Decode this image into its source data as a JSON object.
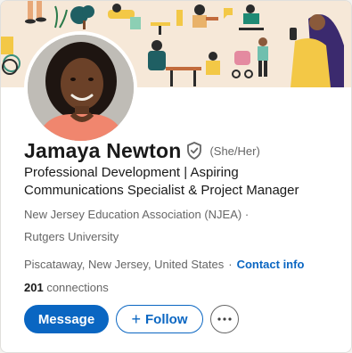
{
  "profile": {
    "name": "Jamaya Newton",
    "pronouns": "(She/Her)",
    "headline": "Professional Development | Aspiring Communications Specialist & Project Manager",
    "education_1": "New Jersey Education Association (NJEA) ·",
    "education_2": "Rutgers University",
    "location": "Piscataway, New Jersey, United States",
    "location_separator": "·",
    "contact_label": "Contact info",
    "connections_count": "201",
    "connections_label": "connections"
  },
  "actions": {
    "message_label": "Message",
    "follow_plus": "+",
    "follow_label": "Follow"
  },
  "icons": {
    "verify": "verified-shield-icon",
    "more": "more-horizontal-icon"
  },
  "colors": {
    "primary": "#0a66c2",
    "text": "#191919",
    "muted": "#666666",
    "banner_bg": "#f6e8d8"
  }
}
